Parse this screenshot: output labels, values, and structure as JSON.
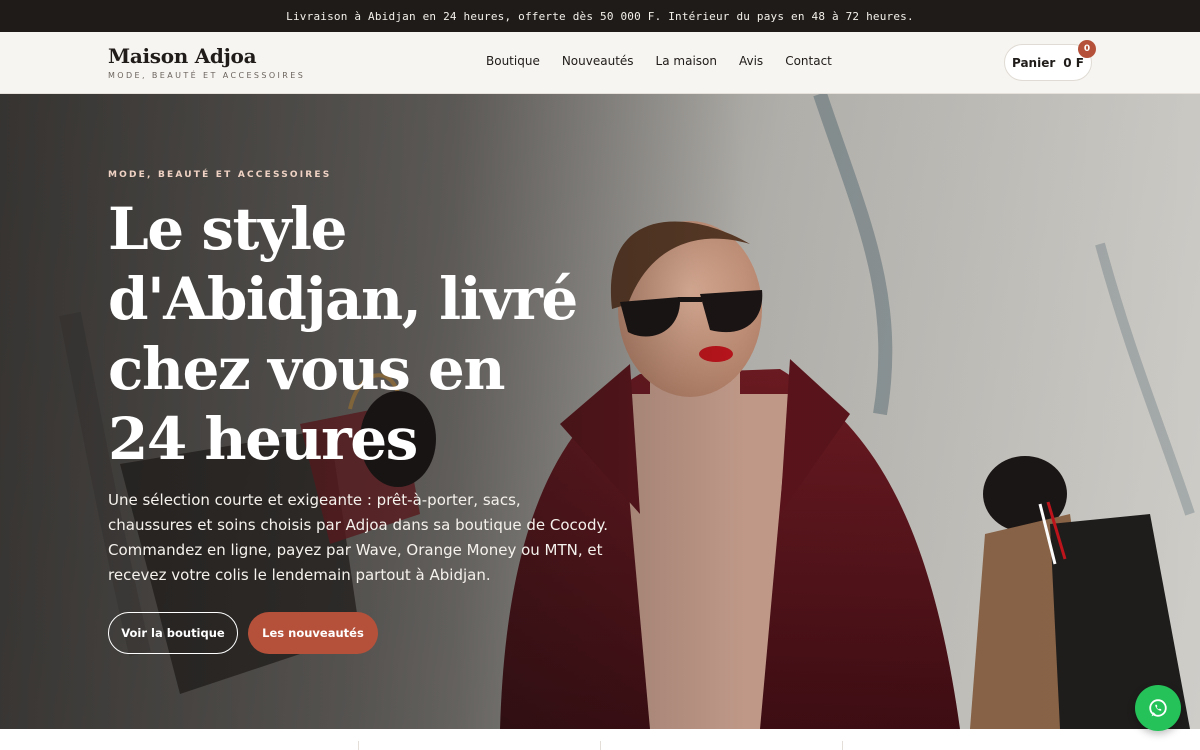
{
  "announcement": "Livraison à Abidjan en 24 heures, offerte dès 50 000 F. Intérieur du pays en 48 à 72 heures.",
  "brand": {
    "name": "Maison Adjoa",
    "tagline": "MODE, BEAUTÉ ET ACCESSOIRES"
  },
  "nav": {
    "items": [
      {
        "label": "Boutique"
      },
      {
        "label": "Nouveautés"
      },
      {
        "label": "La maison"
      },
      {
        "label": "Avis"
      },
      {
        "label": "Contact"
      }
    ]
  },
  "cart": {
    "label": "Panier",
    "total": "0 F",
    "count": "0"
  },
  "hero": {
    "eyebrow": "MODE, BEAUTÉ ET ACCESSOIRES",
    "headline": "Le style d'Abidjan, livré chez vous en 24 heures",
    "description": "Une sélection courte et exigeante : prêt-à-porter, sacs, chaussures et soins choisis par Adjoa dans sa boutique de Cocody. Commandez en ligne, payez par Wave, Orange Money ou MTN, et recevez votre colis le lendemain partout à Abidjan.",
    "primary_button": "Voir la boutique",
    "secondary_button": "Les nouveautés"
  },
  "colors": {
    "accent": "#b5513a",
    "announcement_bg": "#1e1b19",
    "whatsapp": "#25c25a"
  },
  "icons": {
    "whatsapp": "whatsapp-icon"
  }
}
